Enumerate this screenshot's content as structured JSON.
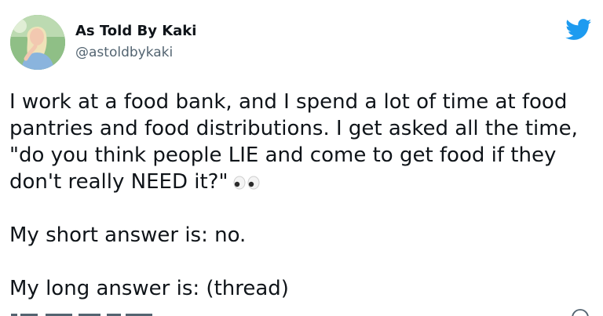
{
  "author": {
    "display_name": "As Told By Kaki",
    "handle": "@astoldbykaki",
    "avatar_icon": "profile-photo"
  },
  "brand": {
    "logo_icon": "twitter-bird-icon",
    "color": "#1d9bf0"
  },
  "tweet": {
    "paragraph_1": "I work at a food bank, and I spend a lot of time at food pantries and food distributions. I get asked all the time, \"do you think people LIE and come to get food if they don't really NEED it?\"",
    "emoji": "eyes-emoji",
    "paragraph_2": "My short answer is: no.",
    "paragraph_3": "My long answer is: (thread)"
  },
  "colors": {
    "text": "#0f1419",
    "secondary_text": "#536471"
  }
}
